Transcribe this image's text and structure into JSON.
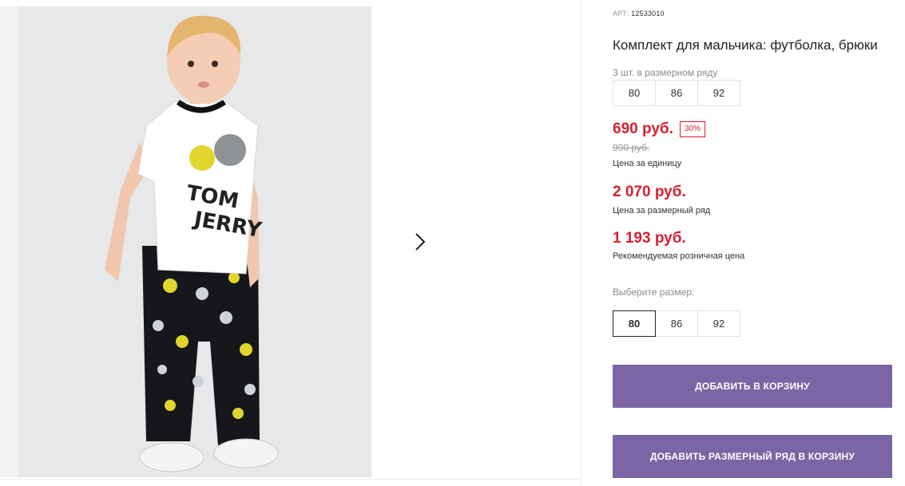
{
  "product": {
    "article_label": "АРТ:",
    "article_number": "12533010",
    "title": "Комплект для мальчика: футболка, брюки",
    "series_label": "3 шт. в размерном ряду",
    "series_sizes": [
      "80",
      "86",
      "92"
    ],
    "price": "690 руб.",
    "discount": "30%",
    "old_price": "990 руб.",
    "unit_price_caption": "Цена за единицу",
    "series_price": "2 070 руб.",
    "series_price_caption": "Цена за размерный ряд",
    "retail_price": "1 193 руб.",
    "retail_price_caption": "Рекомендуемая розничная цена",
    "choose_size_label": "Выберите размер:",
    "sizes": [
      "80",
      "86",
      "92"
    ],
    "selected_size": "80",
    "add_to_cart": "ДОБАВИТЬ В КОРЗИНУ",
    "add_series_to_cart": "ДОБАВИТЬ РАЗМЕРНЫЙ РЯД В КОРЗИНУ"
  },
  "gallery": {
    "next_icon": "chevron-right-icon",
    "print_text_1": "TOM",
    "print_text_2": "JERRY"
  },
  "colors": {
    "price_red": "#d62030",
    "button_purple": "#7b65a4"
  }
}
